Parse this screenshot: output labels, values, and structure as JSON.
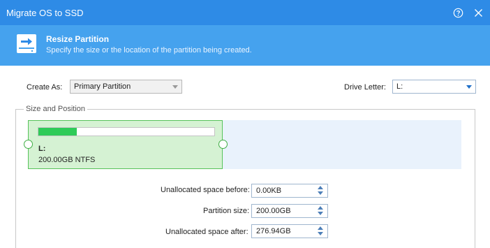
{
  "window": {
    "title": "Migrate OS to SSD",
    "help_icon": "help-icon",
    "close_icon": "close-icon",
    "accent_color": "#2e8be6",
    "header_color": "#45a2ee"
  },
  "header": {
    "icon": "drive-arrow-icon",
    "title": "Resize Partition",
    "subtitle": "Specify the size or the location of the partition being created."
  },
  "form": {
    "create_as_label": "Create As:",
    "create_as_value": "Primary Partition",
    "drive_letter_label": "Drive Letter:",
    "drive_letter_value": "L:"
  },
  "size_position": {
    "group_label": "Size and Position",
    "partition": {
      "letter": "L:",
      "info": "200.00GB NTFS",
      "used_fraction": 0.22,
      "fill_color": "#2fcb58"
    },
    "fields": [
      {
        "label": "Unallocated space before:",
        "value": "0.00KB"
      },
      {
        "label": "Partition size:",
        "value": "200.00GB"
      },
      {
        "label": "Unallocated space after:",
        "value": "276.94GB"
      }
    ]
  }
}
